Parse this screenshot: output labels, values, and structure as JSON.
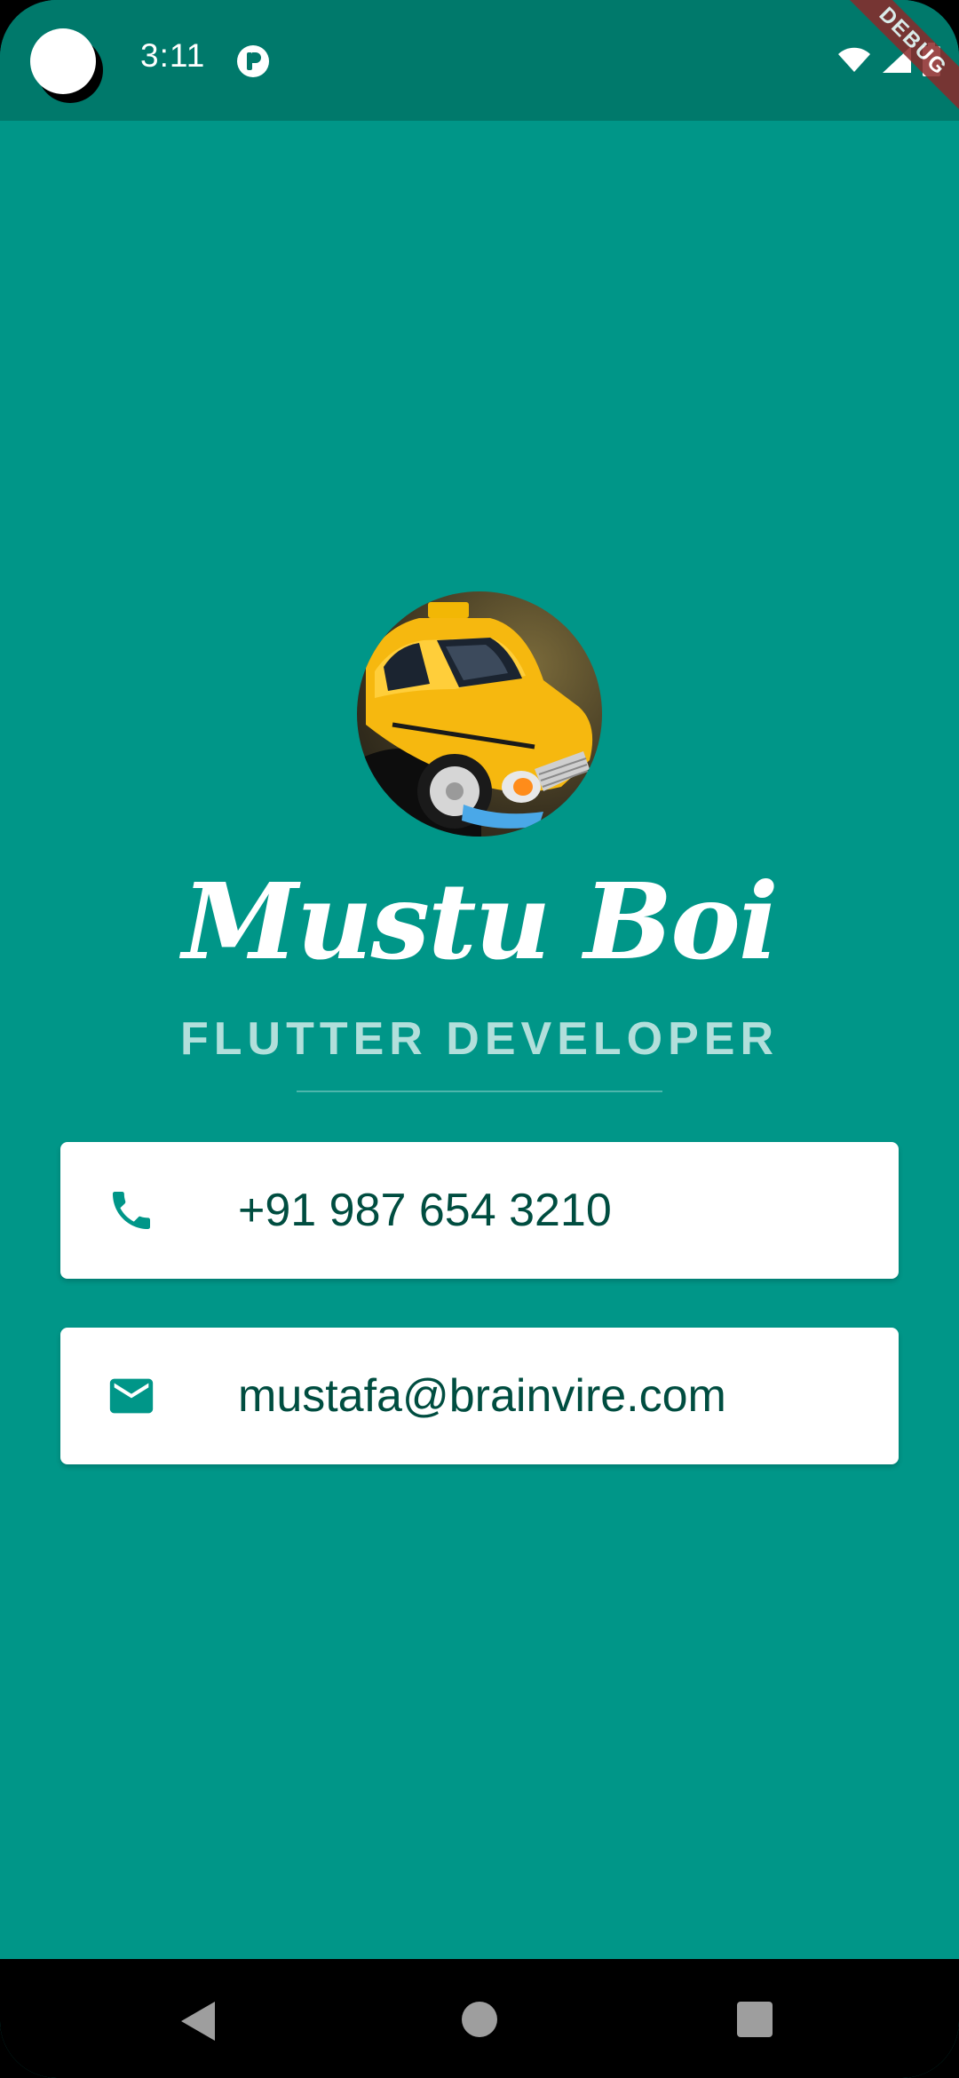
{
  "status_bar": {
    "time": "3:11",
    "debug_label": "DEBUG",
    "icons": [
      "camera-cutout-icon",
      "app-notification-icon",
      "wifi-icon",
      "cell-signal-icon",
      "battery-icon"
    ]
  },
  "profile": {
    "name": "Mustu Boi",
    "title": "FLUTTER DEVELOPER",
    "avatar_icon": "taxi-avatar-image"
  },
  "contacts": {
    "phone": {
      "icon": "phone-icon",
      "text": "+91 987 654 3210"
    },
    "email": {
      "icon": "mail-icon",
      "text": "mustafa@brainvire.com"
    }
  },
  "nav_bar": {
    "buttons": [
      "back-icon",
      "home-icon",
      "recents-icon"
    ]
  },
  "colors": {
    "background": "#009688",
    "status_bar": "#00796b",
    "card_text": "#004d40",
    "icon_teal": "#009688",
    "title_text": "#b2dfdb",
    "debug_banner": "#8b2a2a"
  }
}
